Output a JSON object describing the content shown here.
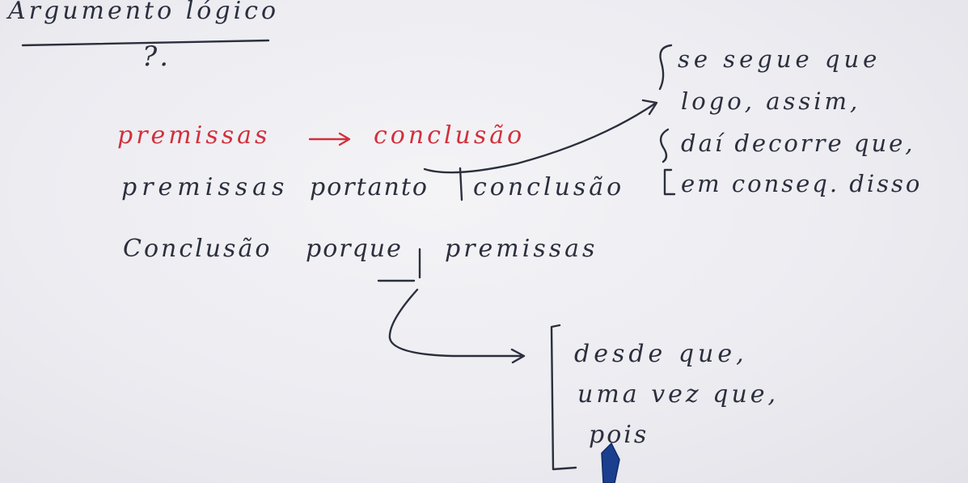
{
  "title": "Argumento lógico",
  "subtitle": "?.",
  "rows": {
    "row1": {
      "premise": "premissas",
      "arrow": "→",
      "conclusion": "conclusão"
    },
    "row2": {
      "premise": "premissas",
      "connective": "portanto",
      "conclusion": "conclusão"
    },
    "row3": {
      "conclusion": "Conclusão",
      "connective": "porque",
      "premise": "premissas"
    }
  },
  "conclusion_indicators": [
    "se segue que",
    "logo, assim,",
    "daí decorre que,",
    "em conseq. disso"
  ],
  "premise_indicators": [
    "desde que,",
    "uma vez que,",
    "pois"
  ],
  "colors": {
    "ink": "#2b2f3d",
    "red": "#d2303c",
    "board": "#ececf1"
  }
}
